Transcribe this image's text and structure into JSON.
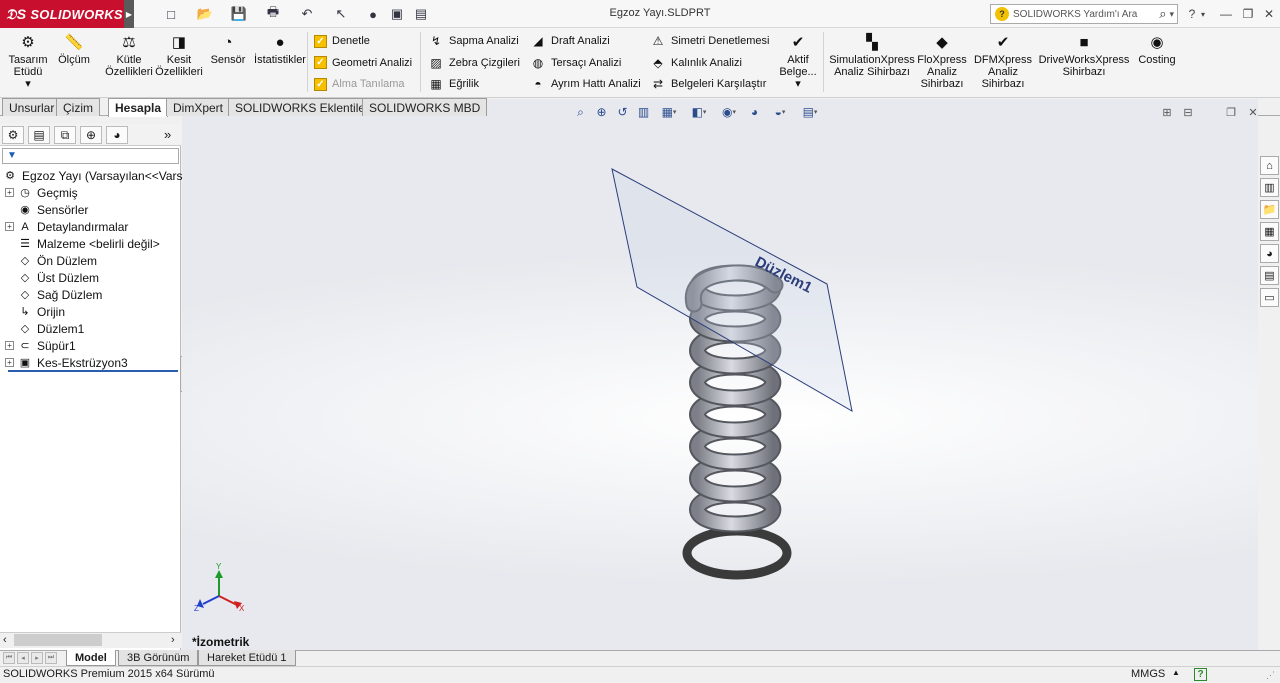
{
  "app": {
    "brand": "SOLIDWORKS",
    "brand_arrow": "▶",
    "document_title": "Egzoz Yayı.SLDPRT"
  },
  "quick_access": [
    {
      "name": "new-document",
      "icon": "□"
    },
    {
      "name": "open",
      "icon": "📂"
    },
    {
      "name": "save",
      "icon": "💾"
    },
    {
      "name": "print",
      "icon": "🖶"
    },
    {
      "name": "undo",
      "icon": "↶"
    },
    {
      "name": "select",
      "icon": "↖"
    },
    {
      "name": "rebuild",
      "icon": "●"
    },
    {
      "name": "file-properties",
      "icon": "▣"
    },
    {
      "name": "options",
      "icon": "▤"
    }
  ],
  "search": {
    "placeholder": "SOLIDWORKS Yardım'ı Ara",
    "q_icon": "?",
    "mag_icon": "⌕",
    "drop": "▾"
  },
  "window_buttons": {
    "help": "?",
    "help_drop": "▾",
    "minimize": "—",
    "restore": "❐",
    "close": "✕"
  },
  "ribbon": {
    "large": [
      {
        "key": "design-study",
        "line1": "Tasarım",
        "line2": "Etüdü",
        "extra": "▾",
        "icon": "⚙"
      },
      {
        "key": "measure",
        "line1": "Ölçüm",
        "line2": "",
        "icon": "📏"
      },
      {
        "key": "mass-properties",
        "line1": "Kütle",
        "line2": "Özellikleri",
        "icon": "⚖"
      },
      {
        "key": "section-properties",
        "line1": "Kesit",
        "line2": "Özellikleri",
        "icon": "◨"
      },
      {
        "key": "sensor",
        "line1": "Sensör",
        "line2": "",
        "icon": "◔"
      },
      {
        "key": "statistics",
        "line1": "İstatistikler",
        "line2": "",
        "icon": "●"
      },
      {
        "key": "active-planes",
        "line1": "Aktif",
        "line2": "Belge...",
        "extra": "▾",
        "icon": "✔"
      },
      {
        "key": "simulationxpress",
        "line1": "SimulationXpress",
        "line2": "Analiz Sihirbazı",
        "icon": "▚"
      },
      {
        "key": "floxpress",
        "line1": "FloXpress",
        "line2": "Analiz",
        "line3": "Sihirbazı",
        "icon": "◆"
      },
      {
        "key": "dfmxpress",
        "line1": "DFMXpress",
        "line2": "Analiz",
        "line3": "Sihirbazı",
        "icon": "✔"
      },
      {
        "key": "driveworksxpress",
        "line1": "DriveWorksXpress",
        "line2": "Sihirbazı",
        "icon": "■"
      },
      {
        "key": "costing",
        "line1": "Costing",
        "line2": "",
        "icon": "◉"
      }
    ],
    "check_col": [
      {
        "key": "denetle",
        "label": "Denetle",
        "icon": "✓",
        "disabled": false
      },
      {
        "key": "geometri",
        "label": "Geometri Analizi",
        "icon": "✓",
        "disabled": false
      },
      {
        "key": "alma",
        "label": "Alma Tanılama",
        "icon": "✓",
        "disabled": true
      }
    ],
    "col2": [
      {
        "key": "sapma",
        "label": "Sapma Analizi",
        "icon": "↯"
      },
      {
        "key": "zebra",
        "label": "Zebra Çizgileri",
        "icon": "▨"
      },
      {
        "key": "egrilik",
        "label": "Eğrilik",
        "icon": "▦"
      }
    ],
    "col3": [
      {
        "key": "draft",
        "label": "Draft Analizi",
        "icon": "◢"
      },
      {
        "key": "tersaci",
        "label": "Tersaçı Analizi",
        "icon": "◍"
      },
      {
        "key": "ayrim",
        "label": "Ayrım Hattı Analizi",
        "icon": "◓"
      }
    ],
    "col4": [
      {
        "key": "simetri",
        "label": "Simetri Denetlemesi",
        "icon": "⚠"
      },
      {
        "key": "kalinlik",
        "label": "Kalınlık Analizi",
        "icon": "⬘"
      },
      {
        "key": "belgeleri",
        "label": "Belgeleri  Karşılaştır",
        "icon": "⇄"
      }
    ]
  },
  "command_tabs": [
    "Unsurlar",
    "Çizim",
    "Hesapla",
    "DimXpert",
    "SOLIDWORKS Eklentileri",
    "SOLIDWORKS MBD"
  ],
  "command_tabs_active": "Hesapla",
  "panel_tabs": [
    "feature-manager",
    "property-manager",
    "configuration-manager",
    "dimxpert-manager",
    "display-manager"
  ],
  "panel_tab_icons": [
    "⚙",
    "▤",
    "⧉",
    "⊕",
    "◕"
  ],
  "panel_more": "»",
  "filter_icon": "▼",
  "tree": {
    "root": "Egzoz Yayı  (Varsayılan<<Varsay",
    "items": [
      {
        "label": "Geçmiş",
        "expand": "+",
        "icon": "◷"
      },
      {
        "label": "Sensörler",
        "expand": "",
        "icon": "◉"
      },
      {
        "label": "Detaylandırmalar",
        "expand": "+",
        "icon": "A"
      },
      {
        "label": "Malzeme <belirli değil>",
        "expand": "",
        "icon": "☰"
      },
      {
        "label": "Ön Düzlem",
        "expand": "",
        "icon": "◇"
      },
      {
        "label": "Üst Düzlem",
        "expand": "",
        "icon": "◇"
      },
      {
        "label": "Sağ Düzlem",
        "expand": "",
        "icon": "◇"
      },
      {
        "label": "Orijin",
        "expand": "",
        "icon": "↳"
      },
      {
        "label": "Düzlem1",
        "expand": "",
        "icon": "◇"
      },
      {
        "label": "Süpür1",
        "expand": "+",
        "icon": "⊂"
      },
      {
        "label": "Kes-Ekstrüzyon3",
        "expand": "+",
        "icon": "▣"
      }
    ]
  },
  "splitter": {
    "top": "◂",
    "bottom": "◂"
  },
  "hscroll": {
    "left": "‹",
    "right": "›"
  },
  "view_toolbar": [
    {
      "key": "zoom-to-fit",
      "icon": "⌕"
    },
    {
      "key": "zoom-area",
      "icon": "⊕"
    },
    {
      "key": "previous-view",
      "icon": "↺"
    },
    {
      "key": "section-view",
      "icon": "▥"
    },
    {
      "key": "dynamic-annotation",
      "icon": "▦",
      "drop": "▾"
    },
    {
      "key": "view-orientation",
      "icon": "◧",
      "drop": "▾"
    },
    {
      "key": "display-style",
      "icon": "◉",
      "drop": "▾"
    },
    {
      "key": "hide-show",
      "icon": "◕"
    },
    {
      "key": "edit-appearance",
      "icon": "◒",
      "drop": "▾"
    },
    {
      "key": "apply-scene",
      "icon": "▤",
      "drop": "▾"
    }
  ],
  "viewport_window": {
    "tile": "⊞",
    "split": "⊟",
    "restore": "❐",
    "close": "✕"
  },
  "plane_label": "Düzlem1",
  "view_name": "*İzometrik",
  "triad": {
    "x": "X",
    "y": "Y",
    "z": "Z"
  },
  "colors": {
    "brand_red": "#c8102e",
    "axis_x": "#d02020",
    "axis_y": "#1d9a2a",
    "axis_z": "#1f3fcf",
    "plane_edge": "#2b3d7a",
    "spring_fill": "#b4b6be"
  },
  "task_pane": [
    {
      "key": "resources",
      "icon": "⌂"
    },
    {
      "key": "design-library",
      "icon": "▥"
    },
    {
      "key": "file-explorer",
      "icon": "📁"
    },
    {
      "key": "view-palette",
      "icon": "▦"
    },
    {
      "key": "appearances",
      "icon": "◕"
    },
    {
      "key": "custom-properties",
      "icon": "▤"
    },
    {
      "key": "solidworks-forum",
      "icon": "▭"
    }
  ],
  "bottom_tabs": [
    "Model",
    "3B Görünüm",
    "Hareket Etüdü 1"
  ],
  "bottom_tabs_active": "Model",
  "bottom_nav": [
    "⏮",
    "◂",
    "▸",
    "⏭"
  ],
  "status": {
    "text": "SOLIDWORKS Premium 2015 x64 Sürümü",
    "units": "MMGS",
    "units_arrow": "▲",
    "help": "?",
    "grip": "⋰"
  }
}
